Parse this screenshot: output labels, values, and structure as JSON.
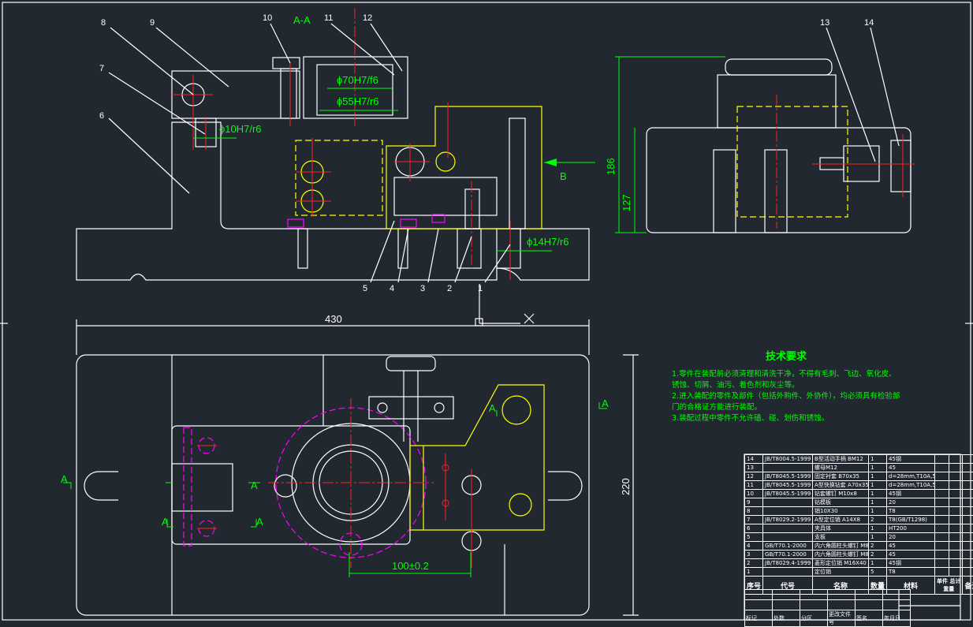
{
  "labels": {
    "section": "A-A",
    "view_b": "B",
    "parts": [
      "1",
      "2",
      "3",
      "4",
      "5",
      "6",
      "7",
      "8",
      "9",
      "10",
      "11",
      "12",
      "13",
      "14"
    ],
    "section_marks": [
      "A",
      "A",
      "A",
      "A",
      "A",
      "A"
    ]
  },
  "dimensions": {
    "width": "430",
    "depth": "220",
    "height_total": "186",
    "height_body": "127",
    "spacing": "100±0.2",
    "fit_70": "ϕ70H7/f6",
    "fit_55": "ϕ55H7/r6",
    "fit_10": "ϕ10H7/r6",
    "fit_14": "ϕ14H7/r6"
  },
  "tech_requirements": {
    "title": "技术要求",
    "items": [
      "1.零件在装配前必须清理和清洗干净，不得有毛刺、飞边、氧化皮、锈蚀、切屑、油污、着色剂和灰尘等。",
      "2.进入装配的零件及部件（包括外购件、外协件），均必须具有检验部门的合格证方能进行装配。",
      "3.装配过程中零件不允许磕、碰、划伤和锈蚀。"
    ]
  },
  "parts_table": {
    "headers": [
      "序号",
      "代号",
      "名称",
      "数量",
      "材料",
      "单件",
      "总计",
      "备注"
    ],
    "weight_header": "重量",
    "rows": [
      [
        "14",
        "JB/T8004.5-1999",
        "B型活动手柄 BM12",
        "1",
        "45钢"
      ],
      [
        "13",
        "",
        "螺母M12",
        "1",
        "45"
      ],
      [
        "12",
        "JB/T8045.5-1999",
        "固定衬套 B70x35",
        "1",
        "d=28mm,T10A,58-64HRC"
      ],
      [
        "11",
        "JB/T8045.5-1999",
        "A型快换钻套 A70x35",
        "1",
        "d=28mm,T10A,58-64HRC"
      ],
      [
        "10",
        "JB/T8045.5-1999",
        "钻套螺钉 M10x8",
        "1",
        "45钢"
      ],
      [
        "9",
        "",
        "钻模板",
        "1",
        "20"
      ],
      [
        "8",
        "",
        "销10X30",
        "1",
        "T8"
      ],
      [
        "7",
        "JB/T8029.2-1999",
        "A型定位销 A14X8",
        "2",
        "T8(GB/T1298)"
      ],
      [
        "6",
        "",
        "夹具体",
        "1",
        "HT200"
      ],
      [
        "5",
        "",
        "支板",
        "1",
        "20"
      ],
      [
        "4",
        "GB/T70.1-2000",
        "内六角圆柱头螺钉 M8X16",
        "2",
        "45"
      ],
      [
        "3",
        "GB/T70.1-2000",
        "内六角圆柱头螺钉 M8X18",
        "2",
        "45"
      ],
      [
        "2",
        "JB/T8029.4-1999",
        "菱形定位销 M16X40",
        "1",
        "45钢"
      ],
      [
        "1",
        "",
        "定位销",
        "5",
        "T8"
      ]
    ],
    "revision_headers": [
      "标记",
      "处数",
      "分区",
      "更改文件号",
      "签名",
      "年月日"
    ]
  },
  "colors": {
    "background": "#212830",
    "outline": "#ffffff",
    "hatch": "#00ffff",
    "workpiece": "#ffff00",
    "centerline": "#ff2020",
    "dimension": "#00ff00",
    "hidden": "#ff00ff"
  }
}
